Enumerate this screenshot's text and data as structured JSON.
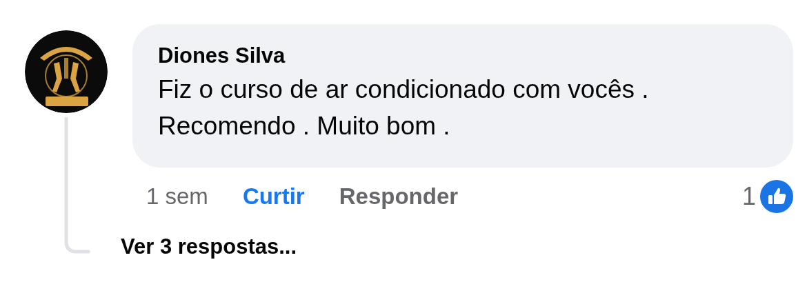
{
  "comment": {
    "author": "Diones Silva",
    "text": "Fiz o curso de ar condicionado com vocês . Recomendo . Muito bom .",
    "time": "1 sem",
    "actions": [
      "Curtir",
      "Responder"
    ],
    "likes": "1",
    "replies_link": "Ver 3 respostas..."
  }
}
